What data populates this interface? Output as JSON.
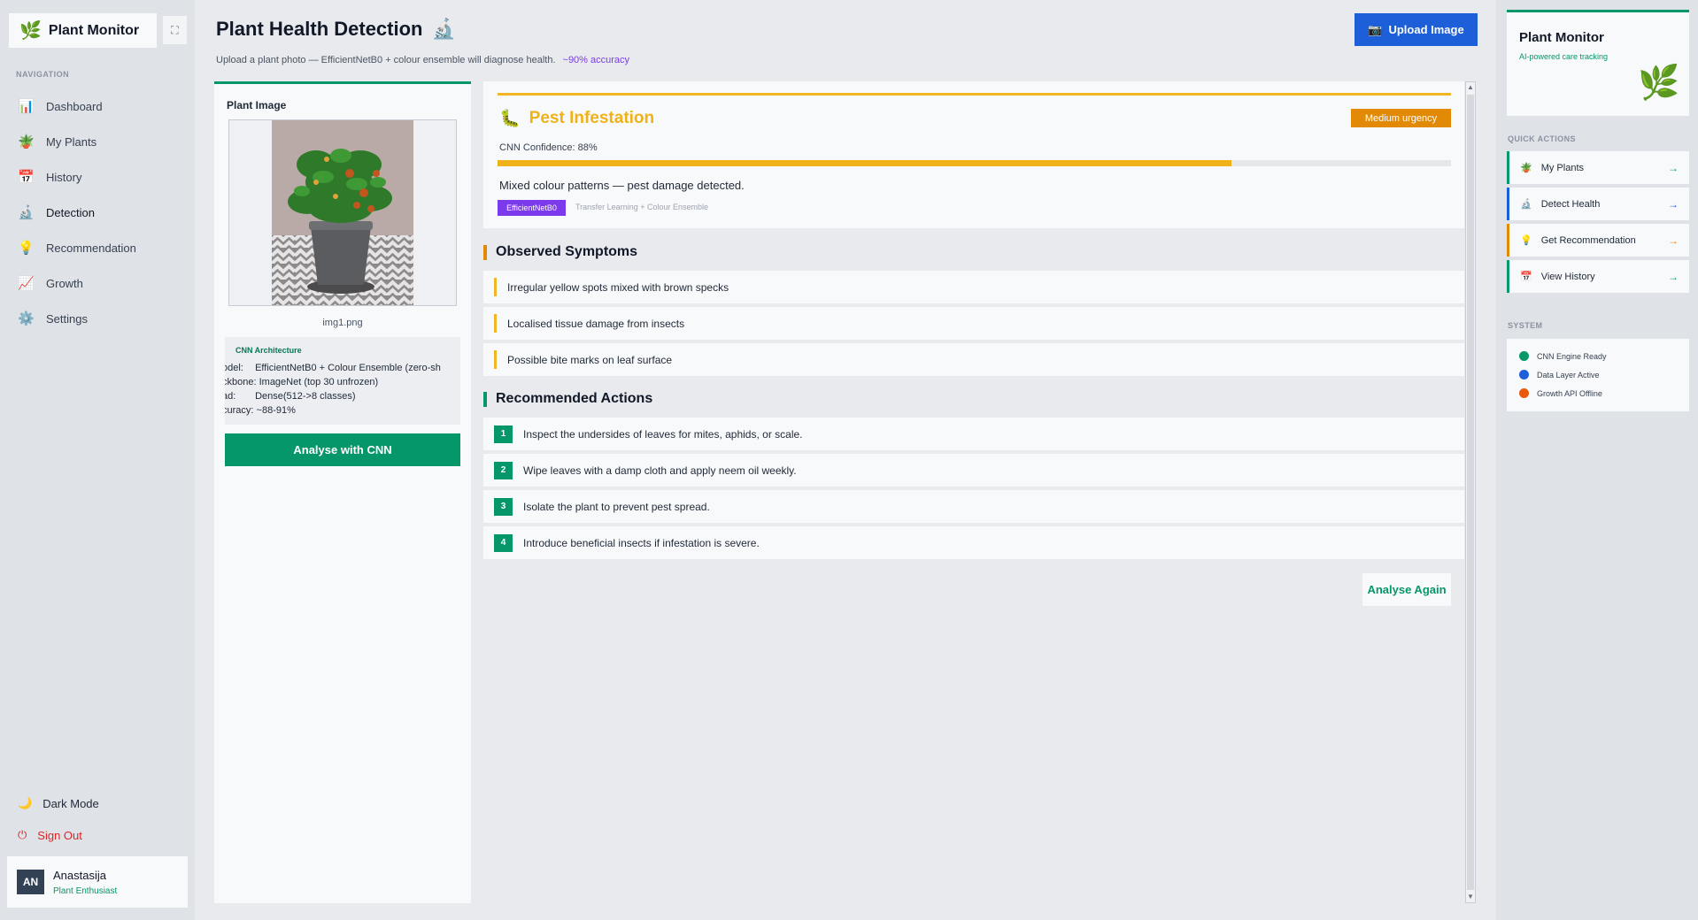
{
  "brand": {
    "name": "Plant Monitor",
    "icon": "leaf-icon"
  },
  "sidebar": {
    "heading": "NAVIGATION",
    "items": [
      {
        "label": "Dashboard",
        "icon": "bar-chart-icon",
        "glyph": "📊"
      },
      {
        "label": "My Plants",
        "icon": "potted-plant-icon",
        "glyph": "🪴"
      },
      {
        "label": "History",
        "icon": "calendar-icon",
        "glyph": "📅"
      },
      {
        "label": "Detection",
        "icon": "microscope-icon",
        "glyph": "🔬"
      },
      {
        "label": "Recommendation",
        "icon": "lightbulb-icon",
        "glyph": "💡"
      },
      {
        "label": "Growth",
        "icon": "trend-chart-icon",
        "glyph": "📈"
      },
      {
        "label": "Settings",
        "icon": "gear-icon",
        "glyph": "⚙️"
      }
    ],
    "active": "Detection",
    "dark_mode": "Dark Mode",
    "sign_out": "Sign Out",
    "user": {
      "initials": "AN",
      "name": "Anastasija",
      "role": "Plant Enthusiast"
    }
  },
  "header": {
    "title": "Plant Health Detection",
    "subtitle": "Upload a plant photo — EfficientNetB0 + colour ensemble will diagnose health.",
    "accuracy": "~90% accuracy",
    "upload_label": "Upload Image"
  },
  "image_panel": {
    "label": "Plant Image",
    "filename": "img1.png",
    "arch_title": "CNN Architecture",
    "arch_lines": [
      {
        "key": "odel:",
        "value": "EfficientNetB0 + Colour Ensemble (zero-sh"
      },
      {
        "key": "ckbone:",
        "value": "ImageNet (top 30 unfrozen)"
      },
      {
        "key": "ad:",
        "value": "Dense(512->8 classes)"
      },
      {
        "key": "curacy:",
        "value": "~88-91%"
      }
    ],
    "analyse_label": "Analyse with CNN"
  },
  "diagnosis": {
    "title": "Pest Infestation",
    "urgency": "Medium urgency",
    "confidence_label": "CNN Confidence: 88%",
    "confidence": 88,
    "message": "Mixed colour patterns — pest damage detected.",
    "model_badge": "EfficientNetB0",
    "model_sub": "Transfer Learning + Colour Ensemble",
    "color": "#f0b219"
  },
  "symptoms": {
    "title": "Observed Symptoms",
    "items": [
      "Irregular yellow spots mixed with brown specks",
      "Localised tissue damage from insects",
      "Possible bite marks on leaf surface"
    ]
  },
  "actions": {
    "title": "Recommended Actions",
    "items": [
      "Inspect the undersides of leaves for mites, aphids, or scale.",
      "Wipe leaves with a damp cloth and apply neem oil weekly.",
      "Isolate the plant to prevent pest spread.",
      "Introduce beneficial insects if infestation is severe."
    ],
    "again_label": "Analyse Again"
  },
  "right_panel": {
    "title": "Plant Monitor",
    "subtitle": "AI-powered care tracking",
    "quick_heading": "QUICK ACTIONS",
    "quick_actions": [
      {
        "label": "My Plants",
        "icon": "potted-plant-icon",
        "glyph": "🪴"
      },
      {
        "label": "Detect Health",
        "icon": "microscope-icon",
        "glyph": "🔬"
      },
      {
        "label": "Get Recommendation",
        "icon": "lightbulb-icon",
        "glyph": "💡"
      },
      {
        "label": "View History",
        "icon": "calendar-icon",
        "glyph": "📅"
      }
    ],
    "system_heading": "SYSTEM",
    "system": [
      {
        "label": "CNN Engine Ready",
        "color": "#059669"
      },
      {
        "label": "Data Layer Active",
        "color": "#1d5fd8"
      },
      {
        "label": "Growth API Offline",
        "color": "#ea580c"
      }
    ]
  }
}
